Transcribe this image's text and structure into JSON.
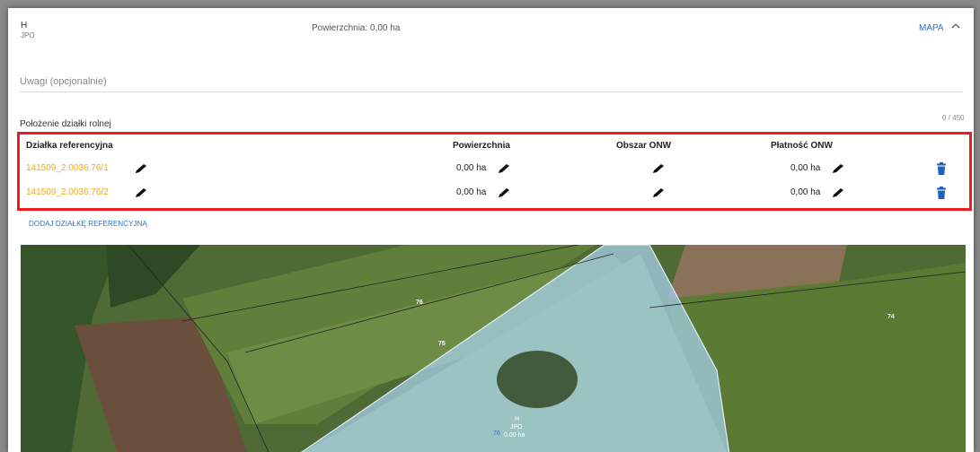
{
  "header": {
    "title": "H",
    "subtitle": "JPO",
    "area_label": "Powierzchnia: 0,00 ha",
    "map_button": "MAPA",
    "collapse_icon": "chevron-up-icon"
  },
  "notes": {
    "placeholder": "Uwagi (opcjonalnie)",
    "counter": "0 / 450"
  },
  "location": {
    "label": "Położenie działki rolnej"
  },
  "table": {
    "columns": [
      "Działka referencyjna",
      "Powierzchnia",
      "Obszar ONW",
      "Płatność ONW"
    ],
    "rows": [
      {
        "parcel": "141509_2.0036.76/1",
        "area": "0,00 ha",
        "onw_area": "",
        "onw_payment": "0,00 ha"
      },
      {
        "parcel": "141509_2.0036.76/2",
        "area": "0,00 ha",
        "onw_area": "",
        "onw_payment": "0,00 ha"
      }
    ],
    "border_color": "#ee1c1c",
    "link_color": "#f2a81b"
  },
  "add_button": "DODAJ DZIAŁKĘ REFERENCYJNĄ",
  "map": {
    "labels": {
      "p76_top": "76",
      "p75": "75",
      "p74": "74",
      "p76_bottom": "76"
    },
    "parcel_label": {
      "name": "H",
      "sub": "JPO",
      "area": "0.00 ha"
    },
    "highlight_color": "#a9d2f0"
  }
}
